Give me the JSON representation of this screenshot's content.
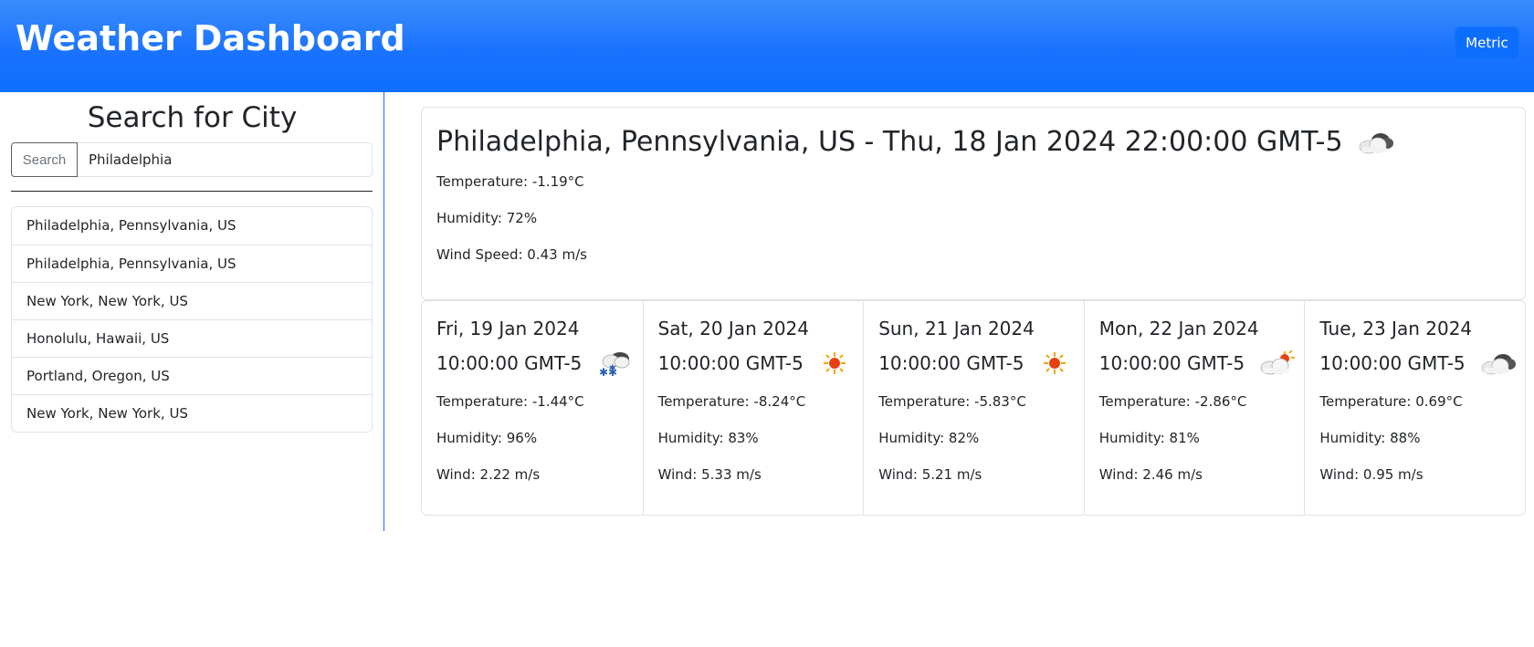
{
  "header": {
    "title": "Weather Dashboard",
    "units_button": "Metric"
  },
  "sidebar": {
    "title": "Search for City",
    "search_label": "Search",
    "search_value": "Philadelphia",
    "history": [
      "Philadelphia, Pennsylvania, US",
      "Philadelphia, Pennsylvania, US",
      "New York, New York, US",
      "Honolulu, Hawaii, US",
      "Portland, Oregon, US",
      "New York, New York, US"
    ]
  },
  "current": {
    "title": "Philadelphia, Pennsylvania, US - Thu, 18 Jan 2024 22:00:00 GMT-5",
    "icon": "cloudy-icon",
    "temperature": "Temperature: -1.19°C",
    "humidity": "Humidity: 72%",
    "wind": "Wind Speed: 0.43 m/s"
  },
  "forecast": [
    {
      "date": "Fri, 19 Jan 2024",
      "time": "10:00:00 GMT-5",
      "icon": "snow-cloud-icon",
      "temperature": "Temperature: -1.44°C",
      "humidity": "Humidity: 96%",
      "wind": "Wind: 2.22 m/s"
    },
    {
      "date": "Sat, 20 Jan 2024",
      "time": "10:00:00 GMT-5",
      "icon": "sun-icon",
      "temperature": "Temperature: -8.24°C",
      "humidity": "Humidity: 83%",
      "wind": "Wind: 5.33 m/s"
    },
    {
      "date": "Sun, 21 Jan 2024",
      "time": "10:00:00 GMT-5",
      "icon": "sun-icon",
      "temperature": "Temperature: -5.83°C",
      "humidity": "Humidity: 82%",
      "wind": "Wind: 5.21 m/s"
    },
    {
      "date": "Mon, 22 Jan 2024",
      "time": "10:00:00 GMT-5",
      "icon": "partly-cloudy-icon",
      "temperature": "Temperature: -2.86°C",
      "humidity": "Humidity: 81%",
      "wind": "Wind: 2.46 m/s"
    },
    {
      "date": "Tue, 23 Jan 2024",
      "time": "10:00:00 GMT-5",
      "icon": "cloudy-icon",
      "temperature": "Temperature: 0.69°C",
      "humidity": "Humidity: 88%",
      "wind": "Wind: 0.95 m/s"
    }
  ],
  "colors": {
    "primary": "#0d6efd",
    "header_gradient_top": "#3a8cfb",
    "text": "#212529",
    "border": "#dee2e6",
    "sun": "#f5a300"
  }
}
